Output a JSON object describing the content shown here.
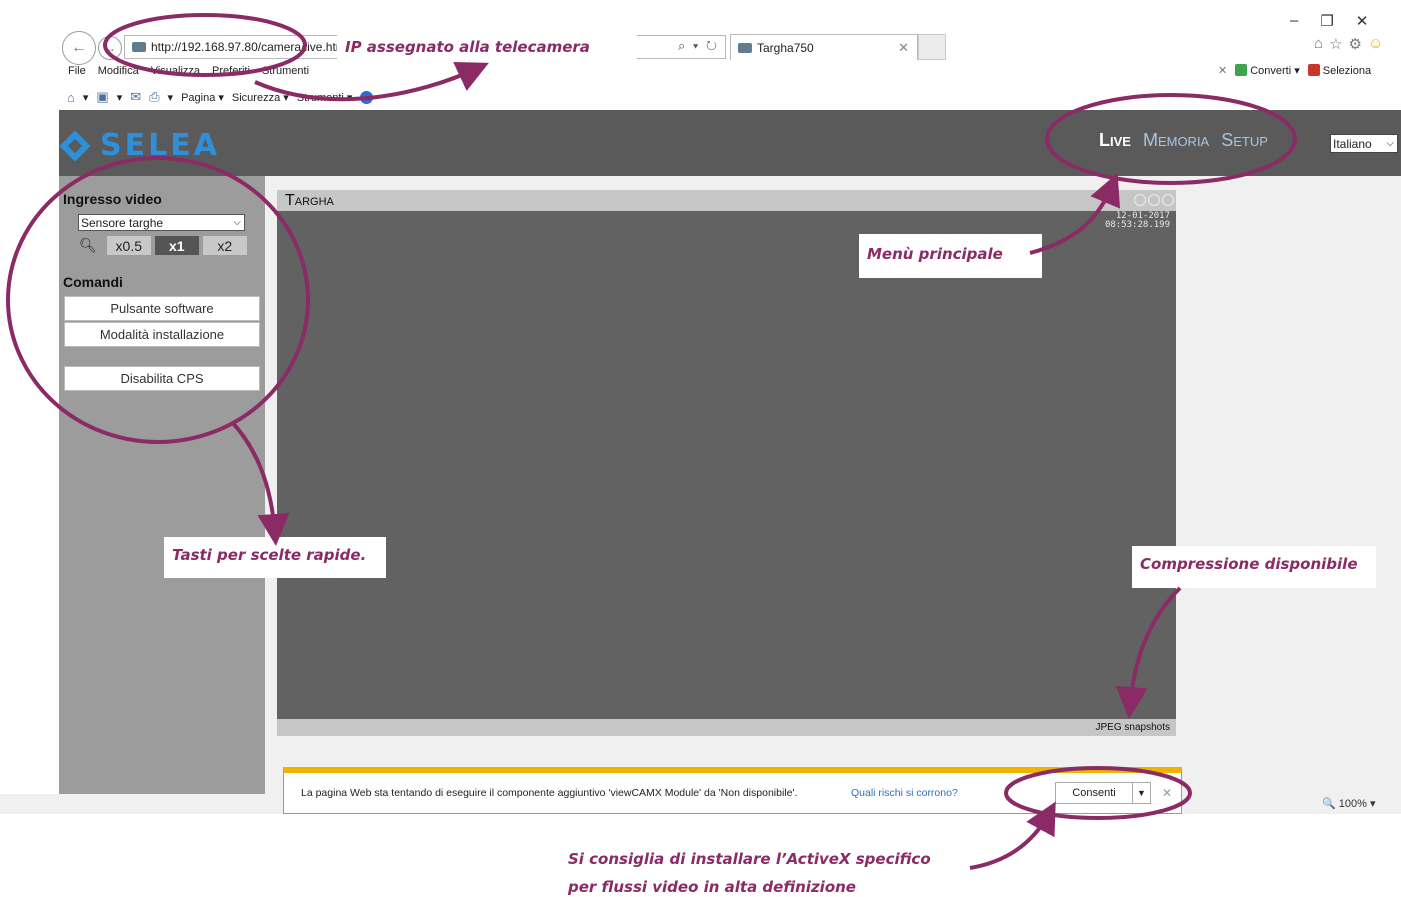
{
  "browser": {
    "url": "http://192.168.97.80/camera/live.html",
    "tab_title": "Targha750",
    "menubar": [
      "File",
      "Modifica",
      "Visualizza",
      "Preferiti",
      "Strumenti"
    ],
    "toolbar": [
      "Pagina",
      "Sicurezza",
      "Strumenti"
    ],
    "right_links": [
      "Converti",
      "Seleziona"
    ],
    "zoom_level": "100%"
  },
  "app": {
    "logo": "SELEA",
    "main_menu": [
      "Live",
      "Memoria",
      "Setup"
    ],
    "active_menu": "Live",
    "language": "Italiano",
    "accent_color": "#2f8fd8",
    "header_color": "#5a5a5a"
  },
  "sidebar": {
    "video_section_title": "Ingresso video",
    "video_source": "Sensore targhe",
    "zoom_options": [
      "x0.5",
      "x1",
      "x2"
    ],
    "zoom_selected": "x1",
    "commands_title": "Comandi",
    "commands": [
      "Pulsante software",
      "Modalità installazione",
      "Disabilita CPS"
    ]
  },
  "viewer": {
    "title": "Targha",
    "timestamp_date": "12-01-2017",
    "timestamp_time": "08:53:28.199",
    "compression": "JPEG snapshots"
  },
  "notification": {
    "message": "La pagina Web sta tentando di eseguire il componente aggiuntivo 'viewCAMX Module' da 'Non disponibile'.",
    "link": "Quali rischi si corrono?",
    "allow_label": "Consenti",
    "bar_color": "#f0b400"
  },
  "annotations": {
    "ip": "IP assegnato alla telecamera",
    "main_menu": "Menù principale",
    "shortcuts": "Tasti per scelte rapide.",
    "compression": "Compressione disponibile",
    "activex_line1": "Si consiglia di installare l’ActiveX specifico",
    "activex_line2": "per flussi video in alta definizione",
    "color": "#8b2b66"
  }
}
